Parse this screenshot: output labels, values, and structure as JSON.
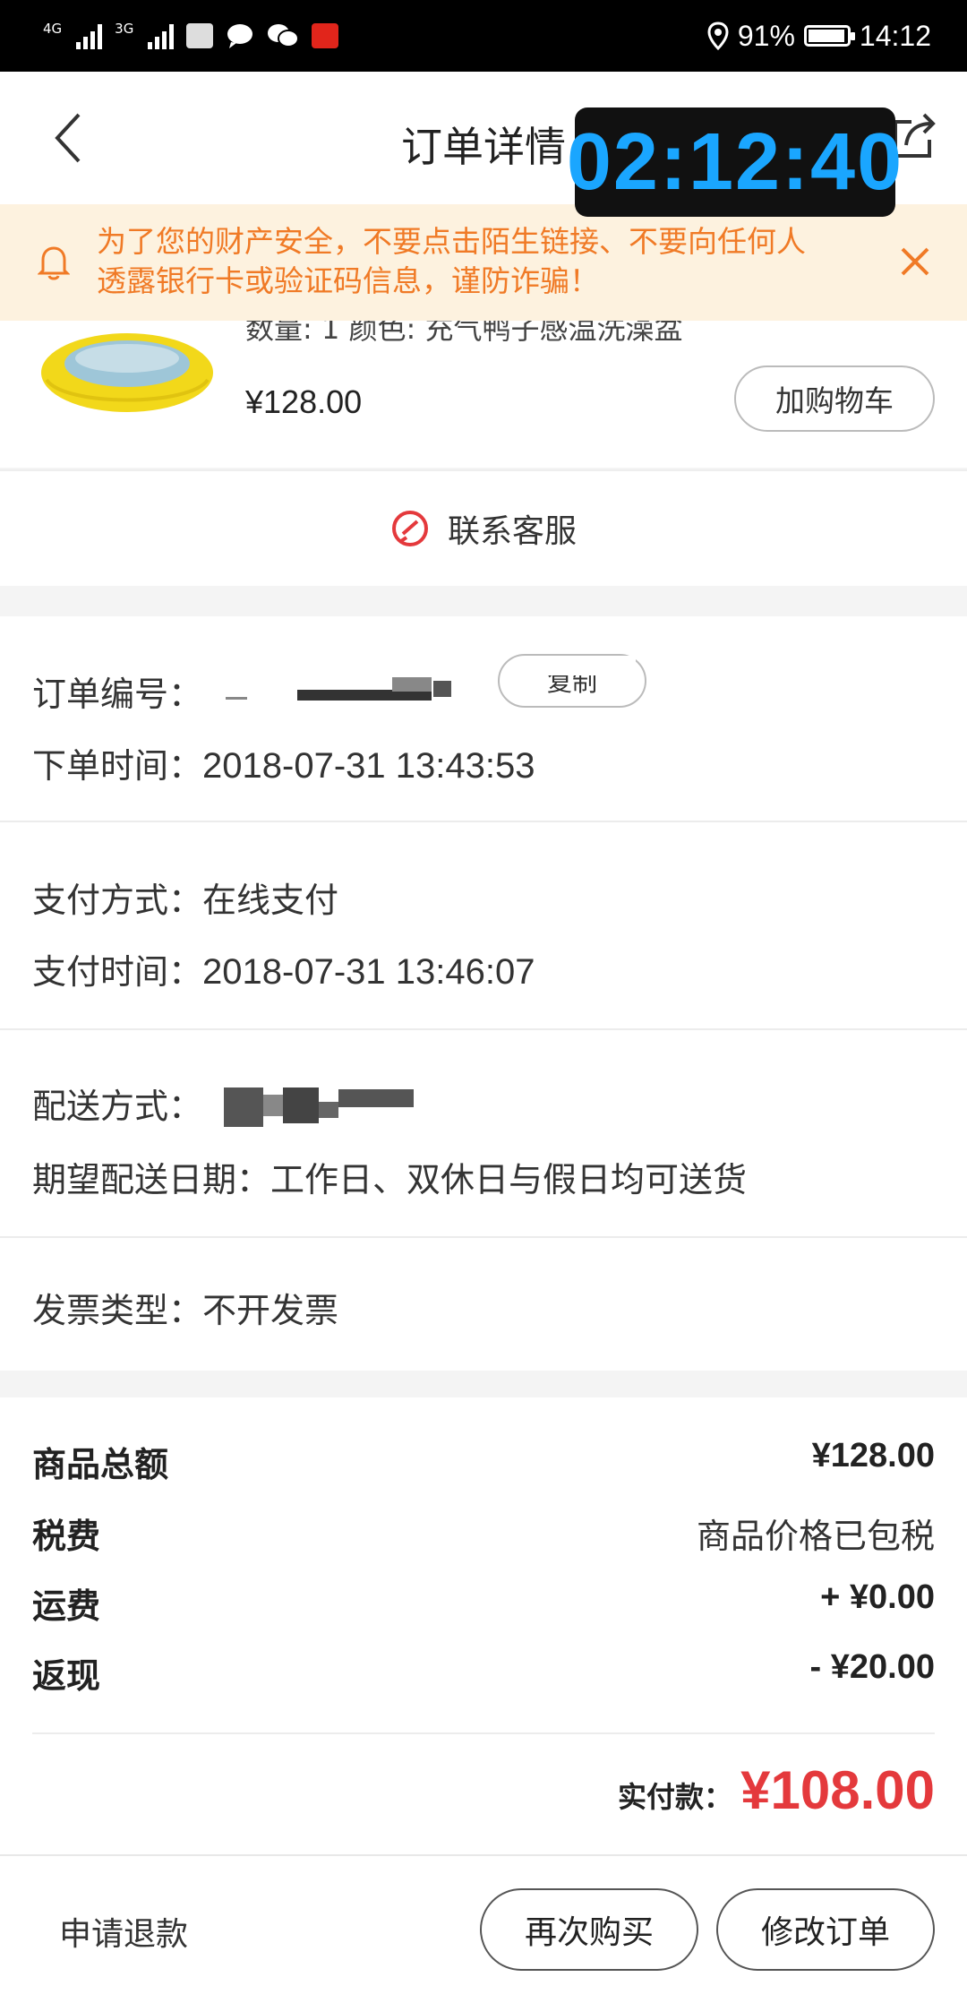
{
  "status_bar": {
    "network_1": "4G",
    "network_2": "3G",
    "battery": "91%",
    "time": "14:12"
  },
  "nav": {
    "title": "订单详情",
    "back_icon": "chevron-left-icon",
    "share_icon": "share-icon"
  },
  "timer_overlay": "02:12:40",
  "warning": {
    "line1": "为了您的财产安全，不要点击陌生链接、不要向任何人",
    "line2": "透露银行卡或验证码信息，谨防诈骗！",
    "color": "#f07a26"
  },
  "product": {
    "spec": "数量: 1 颜色: 充气鸭子感温洗澡盆",
    "price": "¥128.00",
    "add_cart": "加购物车"
  },
  "customer_service": "联系客服",
  "order_info": {
    "order_no_label": "订单编号：",
    "copy": "复制",
    "order_time_label": "下单时间：",
    "order_time": "2018-07-31 13:43:53",
    "pay_method_label": "支付方式：",
    "pay_method": "在线支付",
    "pay_time_label": "支付时间：",
    "pay_time": "2018-07-31 13:46:07",
    "delivery_label": "配送方式：",
    "expected_label": "期望配送日期：",
    "expected": "工作日、双休日与假日均可送货",
    "invoice_label": "发票类型：",
    "invoice": "不开发票"
  },
  "summary": {
    "total_label": "商品总额",
    "total": "¥128.00",
    "tax_label": "税费",
    "tax": "商品价格已包税",
    "shipping_label": "运费",
    "shipping": "+ ¥0.00",
    "cashback_label": "返现",
    "cashback": "- ¥20.00",
    "paid_label": "实付款：",
    "paid": "¥108.00",
    "accent_color": "#e4393c"
  },
  "bottom": {
    "refund": "申请退款",
    "buy_again": "再次购买",
    "modify": "修改订单"
  }
}
